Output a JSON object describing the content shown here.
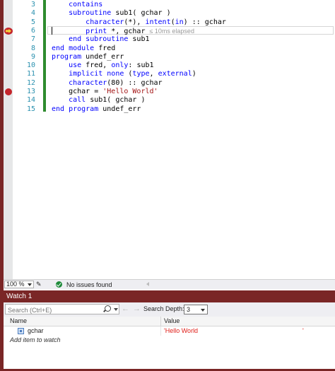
{
  "editor": {
    "lines": [
      {
        "num": "3",
        "indent": "    ",
        "tokens": [
          {
            "t": "contains",
            "c": "kw"
          }
        ]
      },
      {
        "num": "4",
        "indent": "    ",
        "tokens": [
          {
            "t": "subroutine",
            "c": "kw"
          },
          {
            "t": " sub1( gchar )",
            "c": ""
          }
        ]
      },
      {
        "num": "5",
        "indent": "        ",
        "tokens": [
          {
            "t": "character",
            "c": "kw"
          },
          {
            "t": "(*), ",
            "c": ""
          },
          {
            "t": "intent",
            "c": "kw"
          },
          {
            "t": "(",
            "c": ""
          },
          {
            "t": "in",
            "c": "kw"
          },
          {
            "t": ") :: gchar",
            "c": ""
          }
        ]
      },
      {
        "num": "6",
        "indent": "        ",
        "tokens": [
          {
            "t": "print",
            "c": "kw"
          },
          {
            "t": " *, gchar",
            "c": ""
          }
        ]
      },
      {
        "num": "7",
        "indent": "    ",
        "tokens": [
          {
            "t": "end subroutine",
            "c": "kw"
          },
          {
            "t": " sub1",
            "c": ""
          }
        ]
      },
      {
        "num": "8",
        "indent": "",
        "tokens": [
          {
            "t": "end module",
            "c": "kw"
          },
          {
            "t": " fred",
            "c": ""
          }
        ]
      },
      {
        "num": "9",
        "indent": "",
        "tokens": [
          {
            "t": "program",
            "c": "kw"
          },
          {
            "t": " undef_err",
            "c": ""
          }
        ]
      },
      {
        "num": "10",
        "indent": "    ",
        "tokens": [
          {
            "t": "use",
            "c": "kw"
          },
          {
            "t": " fred, ",
            "c": ""
          },
          {
            "t": "only",
            "c": "kw"
          },
          {
            "t": ": sub1",
            "c": ""
          }
        ]
      },
      {
        "num": "11",
        "indent": "    ",
        "tokens": [
          {
            "t": "implicit none",
            "c": "kw"
          },
          {
            "t": " (",
            "c": ""
          },
          {
            "t": "type",
            "c": "kw"
          },
          {
            "t": ", ",
            "c": ""
          },
          {
            "t": "external",
            "c": "kw"
          },
          {
            "t": ")",
            "c": ""
          }
        ]
      },
      {
        "num": "12",
        "indent": "    ",
        "tokens": [
          {
            "t": "character",
            "c": "kw"
          },
          {
            "t": "(80) :: gchar",
            "c": ""
          }
        ]
      },
      {
        "num": "13",
        "indent": "    ",
        "tokens": [
          {
            "t": "gchar = ",
            "c": ""
          },
          {
            "t": "'Hello World'",
            "c": "str"
          }
        ]
      },
      {
        "num": "14",
        "indent": "    ",
        "tokens": [
          {
            "t": "call",
            "c": "kw"
          },
          {
            "t": " sub1( gchar )",
            "c": ""
          }
        ]
      },
      {
        "num": "15",
        "indent": "",
        "tokens": [
          {
            "t": "end program",
            "c": "kw"
          },
          {
            "t": " undef_err",
            "c": ""
          }
        ]
      }
    ],
    "elapsed_hint": "≤ 10ms elapsed",
    "current_line": "6",
    "breakpoint_lines": [
      "13"
    ]
  },
  "status": {
    "zoom": "100 %",
    "issues": "No issues found"
  },
  "watch": {
    "title": "Watch 1",
    "search_placeholder": "Search (Ctrl+E)",
    "depth_label": "Search Depth:",
    "depth_value": "3",
    "col_name": "Name",
    "col_value": "Value",
    "rows": [
      {
        "name": "gchar",
        "value": "'Hello World",
        "value_end": "'"
      }
    ],
    "add_item": "Add item to watch"
  },
  "colors": {
    "frame": "#7a2626",
    "keyword": "#0000ff",
    "string": "#a31515",
    "line_number": "#2b91af",
    "changed_value": "#e0201a"
  }
}
